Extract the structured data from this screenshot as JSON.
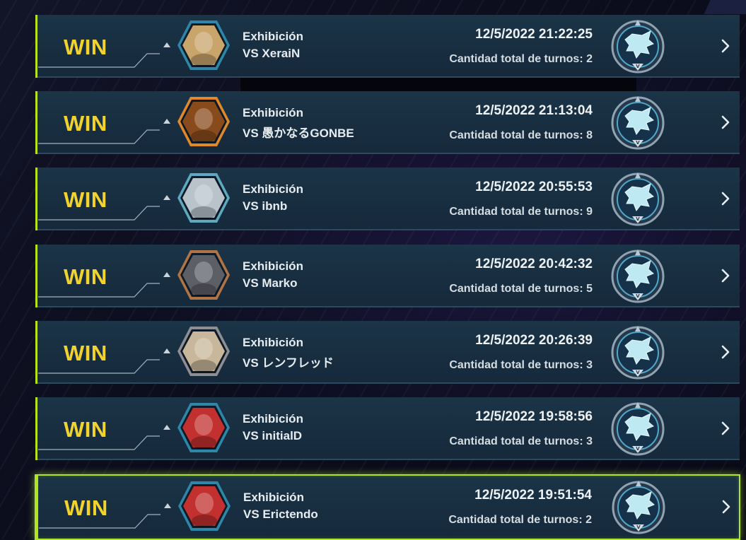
{
  "duel_history": [
    {
      "result": "WIN",
      "mode": "Exhibición",
      "opponent": "VS XeraiN",
      "datetime": "12/5/2022 21:22:25",
      "turns": "Cantidad total de turnos: 2",
      "avatar_icon": "blonde-girl-avatar-icon",
      "avatar_color": "#c9a56b",
      "frame_color": "#2e87a8",
      "rank_icon": "wolf-rank-badge-icon"
    },
    {
      "result": "WIN",
      "mode": "Exhibición",
      "opponent": "VS 愚かなるGONBE",
      "datetime": "12/5/2022 21:13:04",
      "turns": "Cantidad total de turnos: 8",
      "avatar_icon": "kuriboh-avatar-icon",
      "avatar_color": "#8a4b1c",
      "frame_color": "#e0882a",
      "rank_icon": "wolf-rank-badge-icon"
    },
    {
      "result": "WIN",
      "mode": "Exhibición",
      "opponent": "VS ibnb",
      "datetime": "12/5/2022 20:55:53",
      "turns": "Cantidad total de turnos: 9",
      "avatar_icon": "white-hair-avatar-icon",
      "avatar_color": "#b8c3cc",
      "frame_color": "#5ea9c0",
      "rank_icon": "wolf-rank-badge-icon"
    },
    {
      "result": "WIN",
      "mode": "Exhibición",
      "opponent": "VS Marko",
      "datetime": "12/5/2022 20:42:32",
      "turns": "Cantidad total de turnos: 5",
      "avatar_icon": "dragon-avatar-icon",
      "avatar_color": "#5c5f66",
      "frame_color": "#b07446",
      "rank_icon": "wolf-rank-badge-icon"
    },
    {
      "result": "WIN",
      "mode": "Exhibición",
      "opponent": "VS レンフレッド",
      "datetime": "12/5/2022 20:26:39",
      "turns": "Cantidad total de turnos: 3",
      "avatar_icon": "priestess-avatar-icon",
      "avatar_color": "#c8b79a",
      "frame_color": "#8e8e95",
      "rank_icon": "wolf-rank-badge-icon"
    },
    {
      "result": "WIN",
      "mode": "Exhibición",
      "opponent": "VS initialD",
      "datetime": "12/5/2022 19:58:56",
      "turns": "Cantidad total de turnos: 3",
      "avatar_icon": "red-cap-duelist-avatar-icon",
      "avatar_color": "#c2312f",
      "frame_color": "#2e87a8",
      "rank_icon": "wolf-rank-badge-icon"
    },
    {
      "result": "WIN",
      "mode": "Exhibición",
      "opponent": "VS Erictendo",
      "datetime": "12/5/2022 19:51:54",
      "turns": "Cantidad total de turnos: 2",
      "avatar_icon": "red-cap-duelist-avatar-icon",
      "avatar_color": "#c2312f",
      "frame_color": "#2e87a8",
      "rank_icon": "wolf-rank-badge-icon"
    }
  ],
  "colors": {
    "win_text": "#f2d22c",
    "row_accent": "#b8e21c",
    "selected_border": "#aee62a",
    "row_bg": "#183246"
  }
}
